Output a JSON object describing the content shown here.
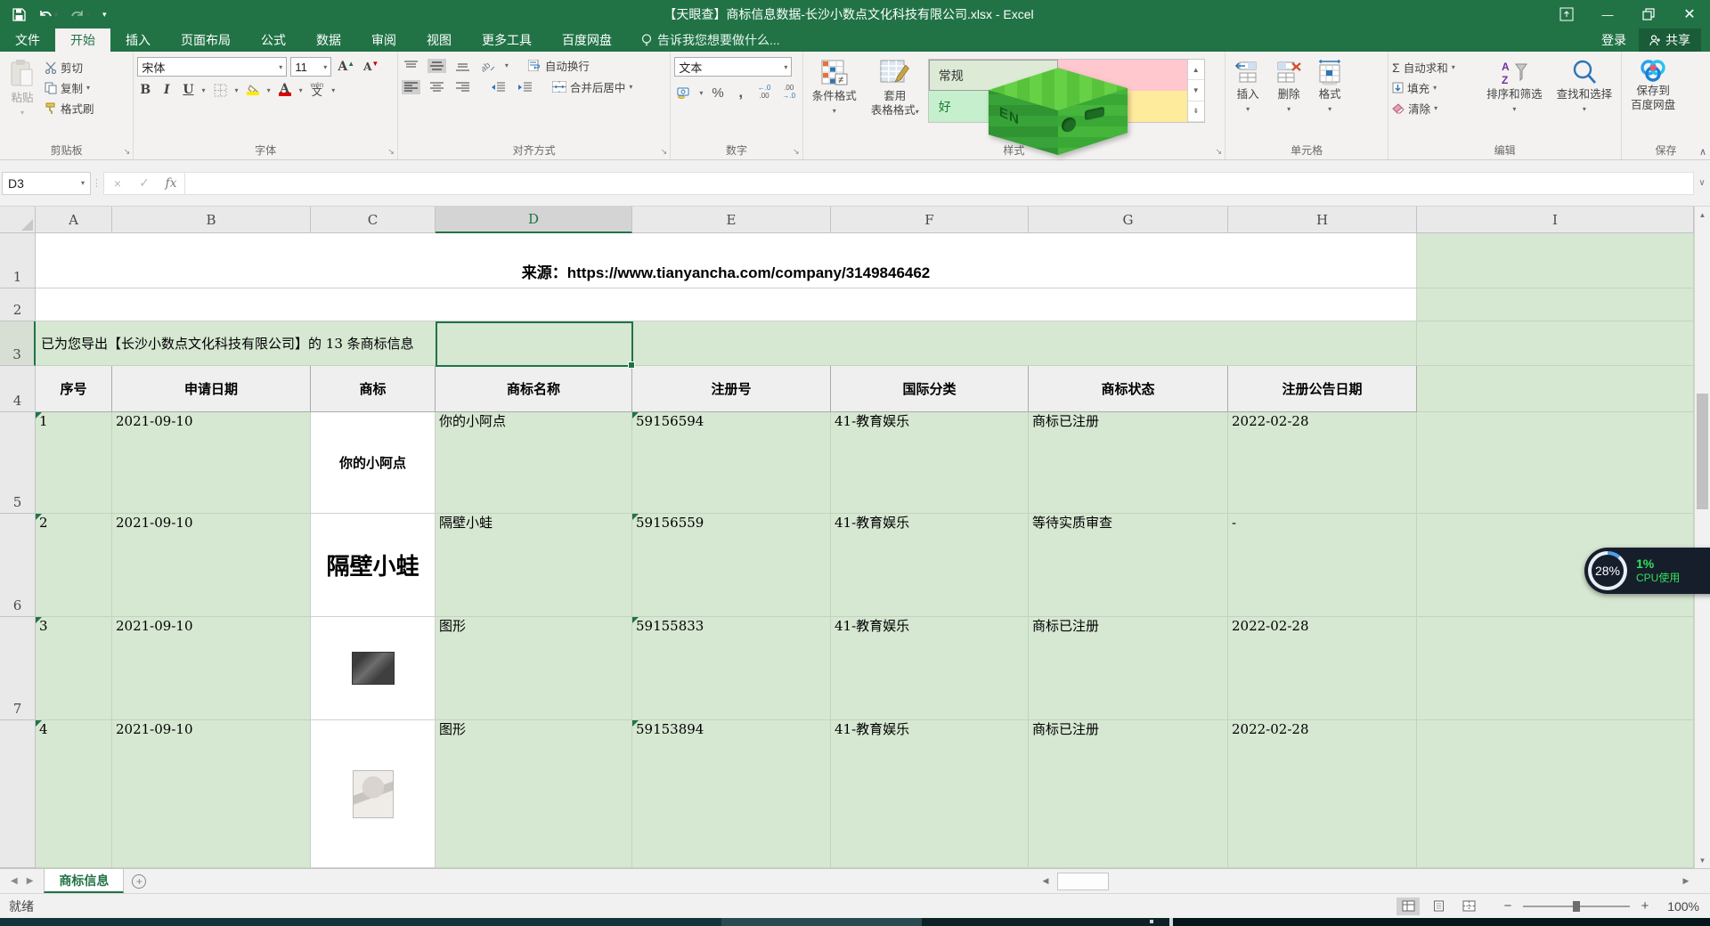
{
  "window": {
    "title": "【天眼查】商标信息数据-长沙小数点文化科技有限公司.xlsx - Excel",
    "signin": "登录",
    "share": "共享"
  },
  "menu": {
    "tabs": [
      "文件",
      "开始",
      "插入",
      "页面布局",
      "公式",
      "数据",
      "审阅",
      "视图",
      "更多工具",
      "百度网盘"
    ],
    "active_tab": "开始",
    "tell_me": "告诉我您想要做什么..."
  },
  "ribbon": {
    "clipboard": {
      "group": "剪贴板",
      "paste": "粘贴",
      "cut": "剪切",
      "copy": "复制",
      "painter": "格式刷"
    },
    "font": {
      "group": "字体",
      "name": "宋体",
      "size": "11",
      "phonetic_top": "wén",
      "phonetic": "文"
    },
    "align": {
      "group": "对齐方式",
      "wrap": "自动换行",
      "merge": "合并后居中"
    },
    "number": {
      "group": "数字",
      "format": "文本"
    },
    "styles": {
      "group": "样式",
      "conditional": "条件格式",
      "table_line1": "套用",
      "table_line2": "表格格式",
      "cell_styles": {
        "normal": "常规",
        "good": "好"
      }
    },
    "cells": {
      "group": "单元格",
      "insert": "插入",
      "delete": "删除",
      "format": "格式"
    },
    "editing": {
      "group": "编辑",
      "autosum": "自动求和",
      "fill": "填充",
      "clear": "清除",
      "sort": "排序和筛选",
      "find": "查找和选择"
    },
    "baidu": {
      "group": "保存",
      "save_line1": "保存到",
      "save_line2": "百度网盘"
    }
  },
  "formula_bar": {
    "name_box": "D3"
  },
  "grid": {
    "columns": [
      "A",
      "B",
      "C",
      "D",
      "E",
      "F",
      "G",
      "H",
      "I"
    ],
    "rows": [
      "1",
      "2",
      "3",
      "4",
      "5",
      "6",
      "7",
      ""
    ],
    "source_row": {
      "text": "来源：https://www.tianyancha.com/company/3149846462"
    },
    "export_row": {
      "text": "已为您导出【长沙小数点文化科技有限公司】的 13 条商标信息"
    },
    "table": {
      "headers": [
        "序号",
        "申请日期",
        "商标",
        "商标名称",
        "注册号",
        "国际分类",
        "商标状态",
        "注册公告日期"
      ],
      "rows": [
        {
          "seq": "1",
          "date": "2021-09-10",
          "mark": "你的小阿点",
          "name": "你的小阿点",
          "reg_no": "59156594",
          "intl_class": "41-教育娱乐",
          "status": "商标已注册",
          "pub_date": "2022-02-28"
        },
        {
          "seq": "2",
          "date": "2021-09-10",
          "mark": "隔壁小蛙",
          "name": "隔壁小蛙",
          "reg_no": "59156559",
          "intl_class": "41-教育娱乐",
          "status": "等待实质审查",
          "pub_date": "-"
        },
        {
          "seq": "3",
          "date": "2021-09-10",
          "mark": "",
          "name": "图形",
          "reg_no": "59155833",
          "intl_class": "41-教育娱乐",
          "status": "商标已注册",
          "pub_date": "2022-02-28"
        },
        {
          "seq": "4",
          "date": "2021-09-10",
          "mark": "",
          "name": "图形",
          "reg_no": "59153894",
          "intl_class": "41-教育娱乐",
          "status": "商标已注册",
          "pub_date": "2022-02-28"
        }
      ]
    }
  },
  "sheet_bar": {
    "active_tab": "商标信息"
  },
  "status_bar": {
    "ready": "就绪",
    "zoom": "100%"
  },
  "cpu_widget": {
    "percent": "28%",
    "usage_percent": "1%",
    "usage_label": "CPU使用"
  },
  "colors": {
    "excel_green": "#217346",
    "grid_green": "#d6e7d2",
    "style_good_bg": "#c6efce",
    "style_bad_bg": "#ffc7ce",
    "style_neutral_bg": "#ffeb9c"
  }
}
